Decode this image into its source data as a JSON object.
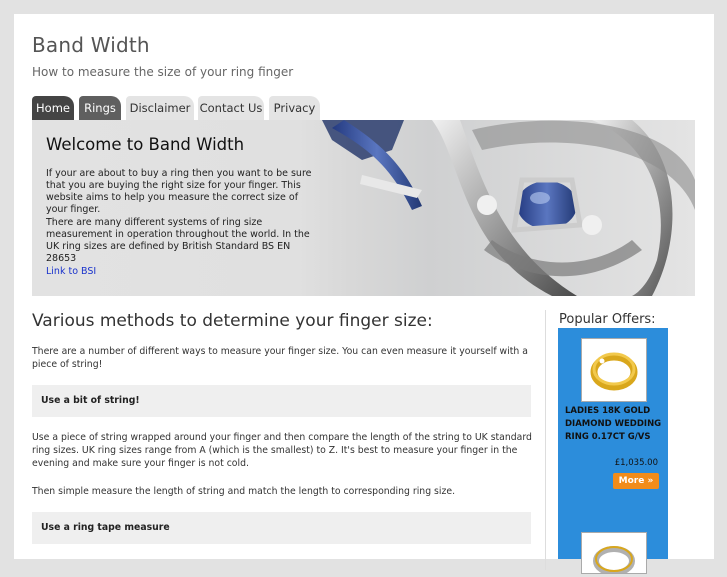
{
  "site": {
    "title": "Band Width",
    "tagline": "How to measure the size of your ring finger"
  },
  "nav": {
    "tabs": [
      {
        "label": "Home",
        "active": true
      },
      {
        "label": "Rings"
      },
      {
        "label": "Disclaimer"
      },
      {
        "label": "Contact Us"
      },
      {
        "label": "Privacy"
      }
    ]
  },
  "hero": {
    "title": "Welcome to Band Width",
    "para1": "If your are about to buy a ring then you want to be sure that you are buying the right size for your finger. This website aims to help you measure the correct size of your finger.",
    "para2": "There are many different systems of ring size measurement in operation throughout the world. In the UK ring sizes are defined by British Standard BS EN 28653",
    "link": "Link to BSI"
  },
  "main": {
    "heading": "Various methods to determine your finger size:",
    "intro": "There are a number of different ways to measure your finger size. You can even measure it yourself with a piece of string!",
    "box1": "Use a bit of string!",
    "para2": "Use a piece of string wrapped around your finger and then compare the length of the string to UK standard ring sizes. UK ring sizes range from A (which is the smallest) to Z. It's best to measure your finger in the evening and make sure your finger is not cold.",
    "para3": "Then simple measure the length of string and match  the length to corresponding ring size.",
    "box2": "Use a ring  tape measure"
  },
  "sidebar": {
    "title": "Popular Offers:",
    "offer1": {
      "title": "LADIES 18K GOLD DIAMOND WEDDING RING 0.17CT G/VS",
      "price": "£1,035.00",
      "button": "More »"
    }
  },
  "colors": {
    "accent_blue": "#2c8ddb",
    "button_orange": "#f28c1a",
    "tab_active": "#444444"
  }
}
